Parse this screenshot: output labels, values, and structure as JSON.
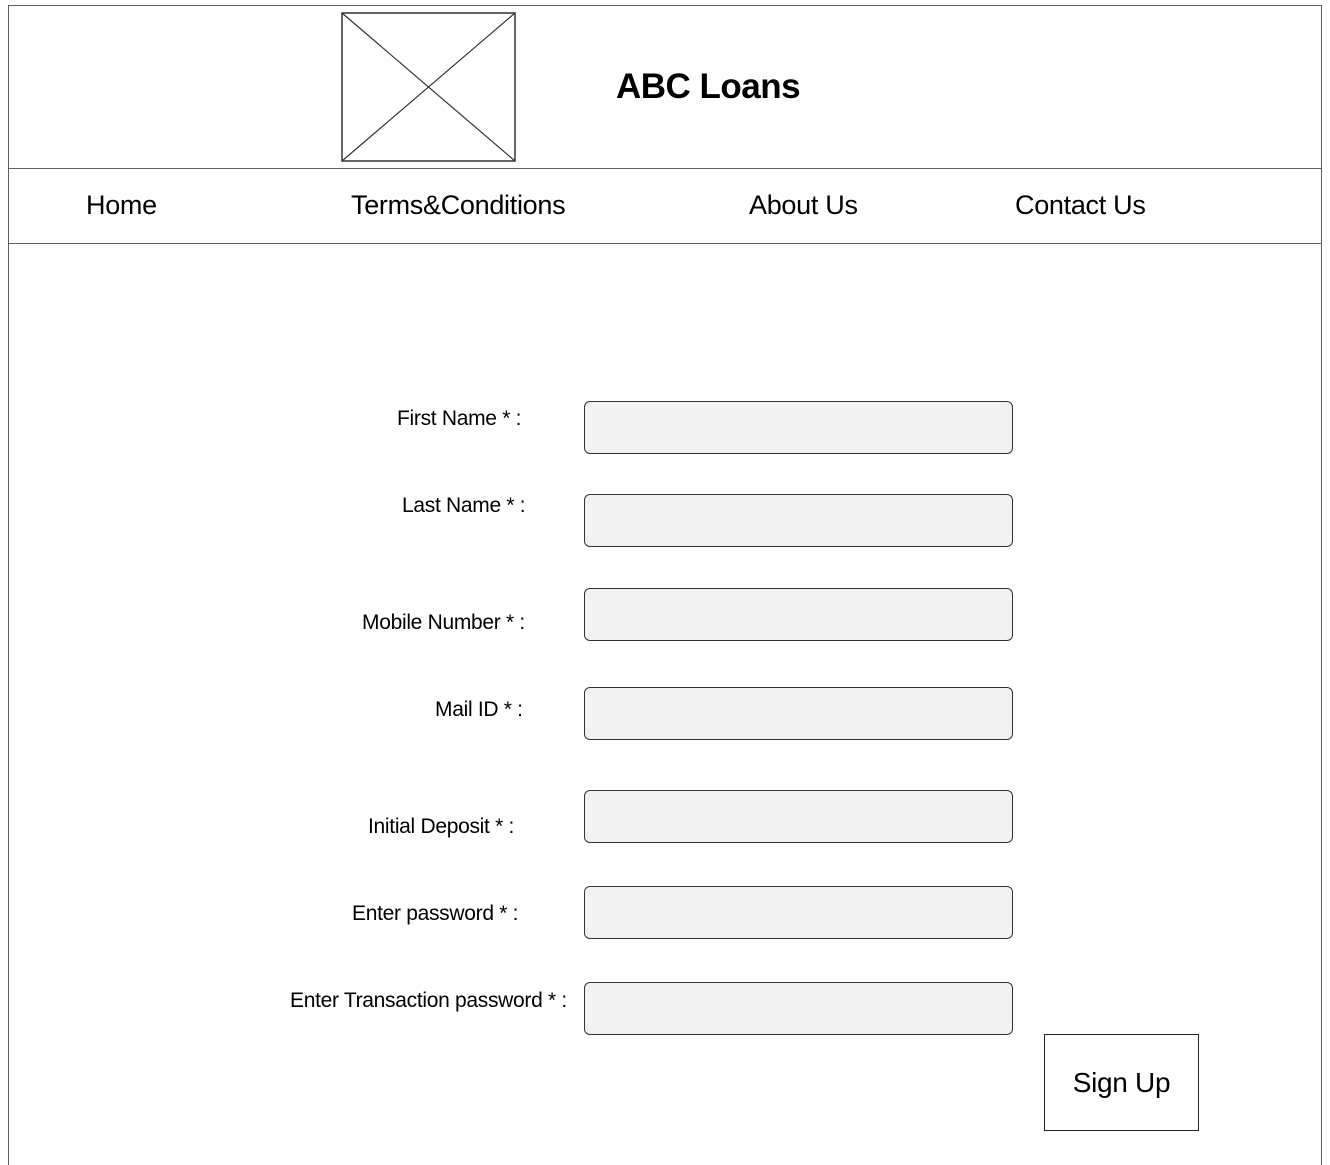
{
  "header": {
    "logo_icon": "image-placeholder-icon",
    "title": "ABC Loans"
  },
  "nav": {
    "items": [
      {
        "label": "Home"
      },
      {
        "label": "Terms&Conditions"
      },
      {
        "label": "About Us"
      },
      {
        "label": "Contact Us"
      }
    ]
  },
  "form": {
    "fields": [
      {
        "label": "First Name * :",
        "value": ""
      },
      {
        "label": "Last Name * :",
        "value": ""
      },
      {
        "label": "Mobile Number * :",
        "value": ""
      },
      {
        "label": "Mail ID * :",
        "value": ""
      },
      {
        "label": "Initial Deposit * :",
        "value": ""
      },
      {
        "label": "Enter password * :",
        "value": ""
      },
      {
        "label": "Enter Transaction password * :",
        "value": ""
      }
    ],
    "submit_label": "Sign Up"
  },
  "colors": {
    "input_background": "#f2f2f2",
    "border": "#5f5f5f"
  }
}
